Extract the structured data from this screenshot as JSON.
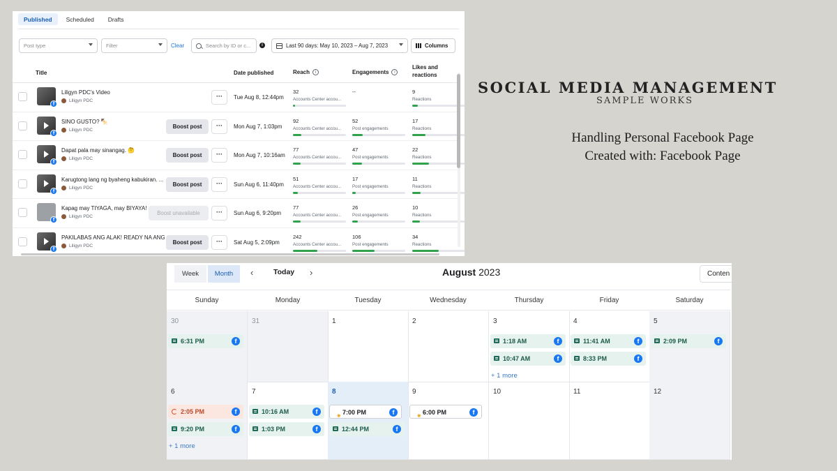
{
  "posts_panel": {
    "tabs": [
      {
        "label": "Published",
        "active": true
      },
      {
        "label": "Scheduled",
        "active": false
      },
      {
        "label": "Drafts",
        "active": false
      }
    ],
    "filters": {
      "post_type_placeholder": "Post type",
      "filter_placeholder": "Filter",
      "clear_label": "Clear",
      "search_placeholder": "Search by ID or c...",
      "date_range": "Last 90 days: May 10, 2023 – Aug 7, 2023",
      "columns_label": "Columns"
    },
    "columns": {
      "title": "Title",
      "date_published": "Date published",
      "reach": "Reach",
      "engagements": "Engagements",
      "likes_reactions": "Likes and reactions"
    },
    "rows": [
      {
        "title": "Liligyn PDC's Video",
        "author": "Liligyn PDC",
        "boost": "",
        "date": "Tue Aug 8, 12:44pm",
        "reach": "32",
        "reach_sub": "Accounts Center accou...",
        "reach_pct": 4,
        "engagements": "--",
        "eng_sub": "",
        "eng_pct": 0,
        "likes": "9",
        "likes_sub": "Reactions",
        "likes_pct": 10
      },
      {
        "title": "SINO GUSTO? 🍢",
        "author": "Liligyn PDC",
        "boost": "Boost post",
        "date": "Mon Aug 7, 1:03pm",
        "reach": "92",
        "reach_sub": "Accounts Center accou...",
        "reach_pct": 16,
        "engagements": "52",
        "eng_sub": "Post engagements",
        "eng_pct": 20,
        "likes": "17",
        "likes_sub": "Reactions",
        "likes_pct": 25
      },
      {
        "title": "Dapat pala may sinangag. 🤔",
        "author": "Liligyn PDC",
        "boost": "Boost post",
        "date": "Mon Aug 7, 10:16am",
        "reach": "77",
        "reach_sub": "Accounts Center accou...",
        "reach_pct": 14,
        "engagements": "47",
        "eng_sub": "Post engagements",
        "eng_pct": 18,
        "likes": "22",
        "likes_sub": "Reactions",
        "likes_pct": 32
      },
      {
        "title": "Karugtong lang ng byaheng kabukiran. ...",
        "author": "Liligyn PDC",
        "boost": "Boost post",
        "date": "Sun Aug 6, 11:40pm",
        "reach": "51",
        "reach_sub": "Accounts Center accou...",
        "reach_pct": 9,
        "engagements": "17",
        "eng_sub": "Post engagements",
        "eng_pct": 7,
        "likes": "11",
        "likes_sub": "Reactions",
        "likes_pct": 16
      },
      {
        "title": "Kapag may TIYAGA, may BIYAYA! ...",
        "author": "Liligyn PDC",
        "boost": "Boost unavailable",
        "date": "Sun Aug 6, 9:20pm",
        "reach": "77",
        "reach_sub": "Accounts Center accou...",
        "reach_pct": 14,
        "engagements": "26",
        "eng_sub": "Post engagements",
        "eng_pct": 10,
        "likes": "10",
        "likes_sub": "Reactions",
        "likes_pct": 14
      },
      {
        "title": "PAKILABAS ANG ALAK! READY NA ANG ...",
        "author": "Liligyn PDC",
        "boost": "Boost post",
        "date": "Sat Aug 5, 2:09pm",
        "reach": "242",
        "reach_sub": "Accounts Center accou...",
        "reach_pct": 46,
        "engagements": "106",
        "eng_sub": "Post engagements",
        "eng_pct": 42,
        "likes": "34",
        "likes_sub": "Reactions",
        "likes_pct": 50
      }
    ]
  },
  "calendar_panel": {
    "view_tabs": [
      {
        "label": "Week",
        "active": false
      },
      {
        "label": "Month",
        "active": true
      }
    ],
    "today_label": "Today",
    "month": "August",
    "year": "2023",
    "content_button": "Conten",
    "weekdays": [
      "Sunday",
      "Monday",
      "Tuesday",
      "Wednesday",
      "Thursday",
      "Friday",
      "Saturday"
    ],
    "week1": [
      {
        "day": "30",
        "events": [
          {
            "time": "6:31 PM",
            "kind": "post"
          }
        ],
        "more": ""
      },
      {
        "day": "31",
        "events": [],
        "more": ""
      },
      {
        "day": "1",
        "events": [],
        "more": ""
      },
      {
        "day": "2",
        "events": [],
        "more": ""
      },
      {
        "day": "3",
        "events": [
          {
            "time": "1:18 AM",
            "kind": "post"
          },
          {
            "time": "10:47 AM",
            "kind": "post"
          }
        ],
        "more": "+ 1 more"
      },
      {
        "day": "4",
        "events": [
          {
            "time": "11:41 AM",
            "kind": "post"
          },
          {
            "time": "8:33 PM",
            "kind": "post"
          }
        ],
        "more": ""
      },
      {
        "day": "5",
        "events": [
          {
            "time": "2:09 PM",
            "kind": "post"
          }
        ],
        "more": ""
      }
    ],
    "week2": [
      {
        "day": "6",
        "events": [
          {
            "time": "2:05 PM",
            "kind": "pending"
          },
          {
            "time": "9:20 PM",
            "kind": "post"
          }
        ],
        "more": "+ 1 more"
      },
      {
        "day": "7",
        "events": [
          {
            "time": "10:16 AM",
            "kind": "post"
          },
          {
            "time": "1:03 PM",
            "kind": "post"
          }
        ],
        "more": ""
      },
      {
        "day": "8",
        "events": [
          {
            "time": "7:00 PM",
            "kind": "scheduled"
          },
          {
            "time": "12:44 PM",
            "kind": "post"
          }
        ],
        "more": ""
      },
      {
        "day": "9",
        "events": [
          {
            "time": "6:00 PM",
            "kind": "scheduled"
          }
        ],
        "more": ""
      },
      {
        "day": "10",
        "events": [],
        "more": ""
      },
      {
        "day": "11",
        "events": [],
        "more": ""
      },
      {
        "day": "12",
        "events": [],
        "more": ""
      }
    ]
  },
  "showcase": {
    "heading": "SOCIAL MEDIA MANAGEMENT",
    "subheading": "SAMPLE WORKS",
    "line1": "Handling Personal Facebook Page",
    "line2": "Created with: Facebook Page"
  },
  "colors": {
    "background": "#d6d4cf",
    "accent_blue": "#1877f2",
    "bar_green": "#31a24c",
    "today_cell": "#e4eef9"
  }
}
